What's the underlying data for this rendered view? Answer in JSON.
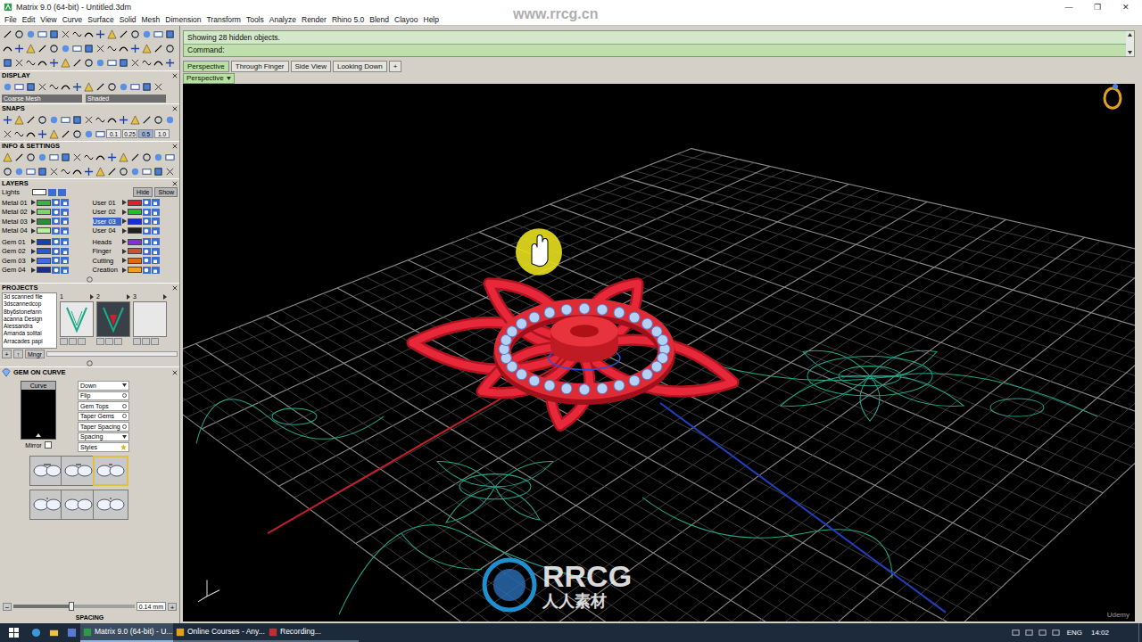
{
  "window": {
    "title": "Matrix 9.0 (64-bit) - Untitled.3dm",
    "controls": [
      "—",
      "❐",
      "✕"
    ]
  },
  "menu": [
    "File",
    "Edit",
    "View",
    "Curve",
    "Surface",
    "Solid",
    "Mesh",
    "Dimension",
    "Transform",
    "Tools",
    "Analyze",
    "Render",
    "Rhino 5.0",
    "Blend",
    "Clayoo",
    "Help"
  ],
  "left_panel": {
    "display": {
      "title": "DISPLAY",
      "mesh": "Coarse Mesh",
      "shading": "Shaded"
    },
    "snaps": {
      "title": "SNAPS",
      "values": [
        {
          "label": "0.1",
          "selected": false
        },
        {
          "label": "0.25",
          "selected": false
        },
        {
          "label": "0.5",
          "selected": true
        },
        {
          "label": "1.0",
          "selected": false
        }
      ]
    },
    "info": {
      "title": "INFO & SETTINGS"
    },
    "layers": {
      "title": "LAYERS",
      "lights": "Lights",
      "hide": "Hide",
      "show": "Show",
      "blocks": [
        [
          {
            "name": "Metal 01",
            "color": "#3fae49",
            "selected": false
          },
          {
            "name": "User 01",
            "color": "#e02020",
            "selected": false
          },
          {
            "name": "Metal 02",
            "color": "#7ed36f",
            "selected": false
          },
          {
            "name": "User 02",
            "color": "#20c020",
            "selected": false
          },
          {
            "name": "Metal 03",
            "color": "#2e8b3e",
            "selected": false
          },
          {
            "name": "User 03",
            "color": "#1030e0",
            "selected": true
          },
          {
            "name": "Metal 04",
            "color": "#b8f0a0",
            "selected": false
          },
          {
            "name": "User 04",
            "color": "#202020",
            "selected": false
          }
        ],
        [
          {
            "name": "Gem 01",
            "color": "#1c3fae",
            "selected": false
          },
          {
            "name": "Heads",
            "color": "#8a2be2",
            "selected": false
          },
          {
            "name": "Gem 02",
            "color": "#2c57d8",
            "selected": false
          },
          {
            "name": "Finger",
            "color": "#c8552a",
            "selected": false
          },
          {
            "name": "Gem 03",
            "color": "#3b6fe0",
            "selected": false
          },
          {
            "name": "Cutting",
            "color": "#e06a10",
            "selected": false
          },
          {
            "name": "Gem 04",
            "color": "#1a2f8a",
            "selected": false
          },
          {
            "name": "Creation",
            "color": "#f0a020",
            "selected": false
          }
        ]
      ]
    },
    "projects": {
      "title": "PROJECTS",
      "items": [
        "3d scanned file",
        "3dscannedcop",
        "8by6stonefann",
        "acanna Design",
        "Alessandra",
        "Amanda solitai",
        "Arracades papi"
      ],
      "thumbs": [
        {
          "label": "1",
          "filled": true,
          "selected": false
        },
        {
          "label": "2",
          "filled": true,
          "selected": true
        },
        {
          "label": "3",
          "filled": false,
          "selected": false
        }
      ],
      "buttons": [
        "+",
        "↑",
        "Mngr"
      ]
    },
    "gem_on_curve": {
      "title": "GEM ON CURVE",
      "curve_label": "Curve",
      "mirror": {
        "label": "Mirror",
        "checked": false
      },
      "options": [
        {
          "label": "Down",
          "kind": "dropdown"
        },
        {
          "label": "Flip",
          "kind": "toggle"
        },
        {
          "label": "Gem Tops",
          "kind": "toggle"
        },
        {
          "label": "Taper Gems",
          "kind": "toggle"
        },
        {
          "label": "Taper Spacing",
          "kind": "toggle"
        },
        {
          "label": "Spacing",
          "kind": "dropdown"
        },
        {
          "label": "Styles",
          "kind": "star"
        }
      ],
      "styles": [
        {
          "selected": false
        },
        {
          "selected": false
        },
        {
          "selected": true
        },
        {
          "selected": false
        },
        {
          "selected": false
        },
        {
          "selected": false
        }
      ],
      "slider": {
        "label": "SPACING",
        "value": "0.14 mm",
        "level": 0.48,
        "minus": "−",
        "plus": "+"
      }
    }
  },
  "command": {
    "history": "Showing 28 hidden objects.",
    "prompt": "Command:"
  },
  "viewport_tabs": [
    {
      "label": "Perspective",
      "selected": true
    },
    {
      "label": "Through Finger",
      "selected": false
    },
    {
      "label": "Side View",
      "selected": false
    },
    {
      "label": "Looking Down",
      "selected": false
    },
    {
      "label": "+",
      "selected": false
    }
  ],
  "viewport": {
    "name": "Perspective"
  },
  "taskbar": {
    "items": [
      {
        "label": "Matrix 9.0 (64-bit) - U...",
        "selected": true
      },
      {
        "label": "Online Courses - Any...",
        "selected": false
      },
      {
        "label": "Recording...",
        "selected": false
      }
    ],
    "language": "ENG",
    "time": "14:02"
  },
  "watermarks": {
    "site": "www.rrcg.cn",
    "brand": "RRCG",
    "brand_cn": "人人素材",
    "course": "Udemy"
  }
}
